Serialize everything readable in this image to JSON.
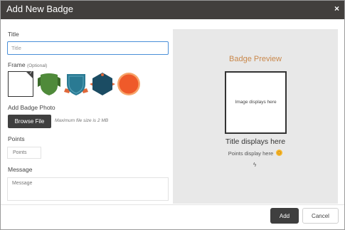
{
  "dialog": {
    "title": "Add New Badge",
    "close_icon": "close-icon",
    "close_glyph": "×"
  },
  "form": {
    "title_label": "Title",
    "title_placeholder": "Title",
    "title_value": "",
    "frame_label": "Frame",
    "frame_optional": "(Optional)",
    "frames": [
      {
        "name": "none",
        "selected": true,
        "color": "#ffffff"
      },
      {
        "name": "green-shield-ribbon",
        "selected": false,
        "color": "#4f8a3a"
      },
      {
        "name": "teal-shield-ribbon",
        "selected": false,
        "color": "#2a7a93"
      },
      {
        "name": "navy-hexagon-ribbon",
        "selected": false,
        "color": "#1b4c63"
      },
      {
        "name": "orange-circle",
        "selected": false,
        "color": "#ef5a2a"
      }
    ],
    "photo_label": "Add Badge Photo",
    "browse_label": "Browse File",
    "file_hint": "Maximum file size is 2 MB",
    "points_label": "Points",
    "points_placeholder": "Points",
    "message_label": "Message",
    "message_placeholder": "Message"
  },
  "preview": {
    "heading": "Badge Preview",
    "image_placeholder": "Image displays here",
    "title_placeholder": "Title displays here",
    "points_placeholder": "Points display here",
    "points_icon": "coin-icon",
    "bolt_icon": "lightning-icon",
    "bolt_glyph": "ϟ",
    "accent_color": "#c9884b"
  },
  "footer": {
    "add_label": "Add",
    "cancel_label": "Cancel"
  },
  "colors": {
    "titlebar": "#423f3d",
    "input_focus": "#4a8fd8",
    "preview_bg": "#e8e8e8",
    "primary_button": "#3f3f3f"
  }
}
